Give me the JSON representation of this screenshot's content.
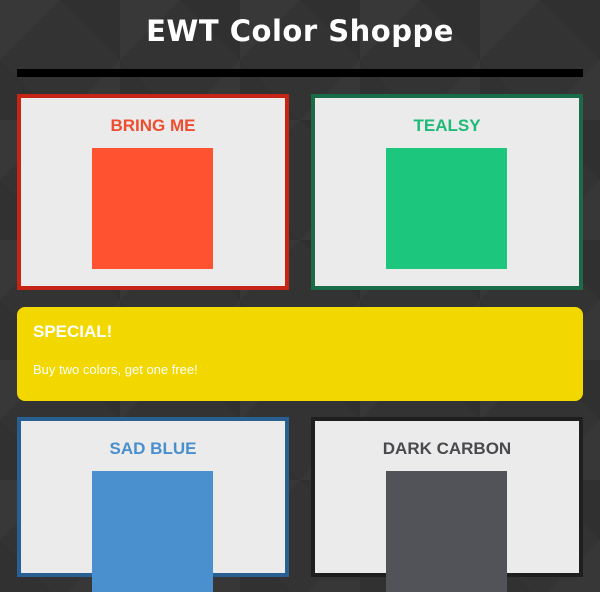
{
  "header": {
    "title": "EWT Color Shoppe"
  },
  "products": [
    {
      "name": "BRING ME",
      "swatch": "#ff5230",
      "border": "#c62414",
      "label_color": "#ee4e30"
    },
    {
      "name": "TEALSY",
      "swatch": "#1cc67c",
      "border": "#1b6a48",
      "label_color": "#1dbb76"
    },
    {
      "name": "SAD BLUE",
      "swatch": "#4a90cf",
      "border": "#2a5f91",
      "label_color": "#4a8fcd"
    },
    {
      "name": "DARK CARBON",
      "swatch": "#525359",
      "border": "#1f1f1f",
      "label_color": "#4a4a4e"
    }
  ],
  "special": {
    "title": "SPECIAL!",
    "text": "Buy two colors, get one free!",
    "background": "#f3d800"
  }
}
